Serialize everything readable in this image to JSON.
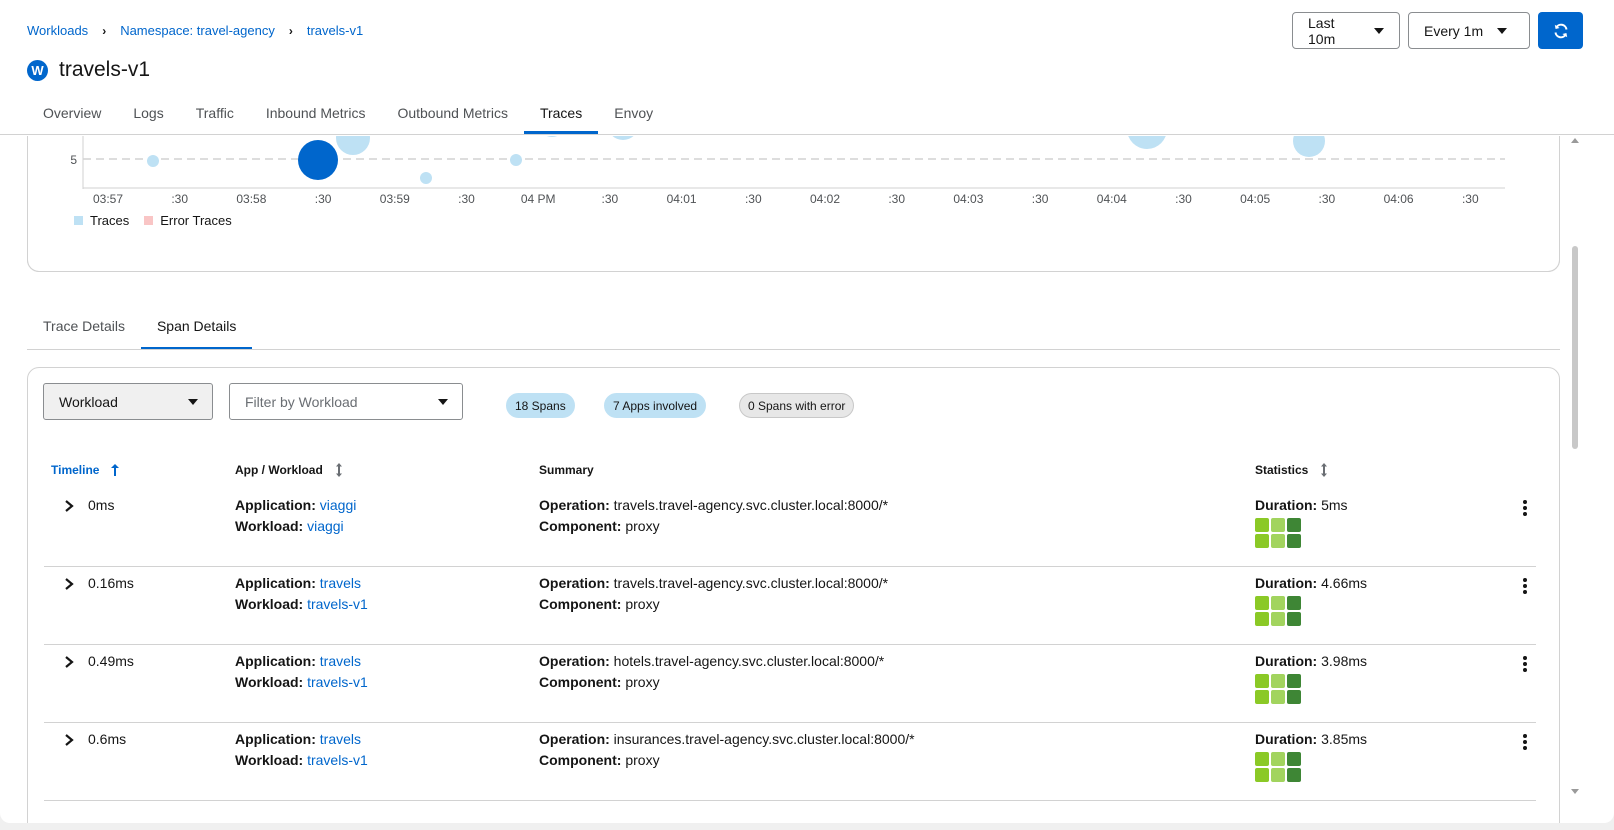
{
  "breadcrumb": {
    "items": [
      "Workloads",
      "Namespace: travel-agency",
      "travels-v1"
    ]
  },
  "header": {
    "badge": "W",
    "title": "travels-v1",
    "time_range": "Last 10m",
    "refresh_interval": "Every 1m"
  },
  "tabs": [
    "Overview",
    "Logs",
    "Traffic",
    "Inbound Metrics",
    "Outbound Metrics",
    "Traces",
    "Envoy"
  ],
  "active_tab": "Traces",
  "chart_data": {
    "type": "scatter",
    "y_tick": "5",
    "x_ticks": [
      "03:57",
      ":30",
      "03:58",
      ":30",
      "03:59",
      ":30",
      "04 PM",
      ":30",
      "04:01",
      ":30",
      "04:02",
      ":30",
      "04:03",
      ":30",
      "04:04",
      ":30",
      "04:05",
      ":30",
      "04:06",
      ":30"
    ],
    "series": [
      {
        "name": "Traces",
        "color": "#bee1f4"
      },
      {
        "name": "Error Traces",
        "color": "#f9c5c5"
      }
    ]
  },
  "subtabs": [
    "Trace Details",
    "Span Details"
  ],
  "active_subtab": "Span Details",
  "filters": {
    "type_select": "Workload",
    "filter_placeholder": "Filter by Workload"
  },
  "badges": {
    "spans": "18 Spans",
    "apps": "7 Apps involved",
    "errors": "0 Spans with error"
  },
  "columns": {
    "timeline": "Timeline",
    "app_workload": "App / Workload",
    "summary": "Summary",
    "statistics": "Statistics"
  },
  "labels": {
    "application": "Application:",
    "workload": "Workload:",
    "operation": "Operation:",
    "component": "Component:",
    "duration": "Duration:"
  },
  "rows": [
    {
      "time": "0ms",
      "application": "viaggi",
      "workload": "viaggi",
      "operation": "travels.travel-agency.svc.cluster.local:8000/*",
      "component": "proxy",
      "duration": "5ms"
    },
    {
      "time": "0.16ms",
      "application": "travels",
      "workload": "travels-v1",
      "operation": "travels.travel-agency.svc.cluster.local:8000/*",
      "component": "proxy",
      "duration": "4.66ms"
    },
    {
      "time": "0.49ms",
      "application": "travels",
      "workload": "travels-v1",
      "operation": "hotels.travel-agency.svc.cluster.local:8000/*",
      "component": "proxy",
      "duration": "3.98ms"
    },
    {
      "time": "0.6ms",
      "application": "travels",
      "workload": "travels-v1",
      "operation": "insurances.travel-agency.svc.cluster.local:8000/*",
      "component": "proxy",
      "duration": "3.85ms"
    }
  ],
  "colors": {
    "accent": "#0066cc",
    "heat_light": "#a2d45e",
    "heat_lime": "#8bc926",
    "heat_dark": "#3e8635"
  }
}
